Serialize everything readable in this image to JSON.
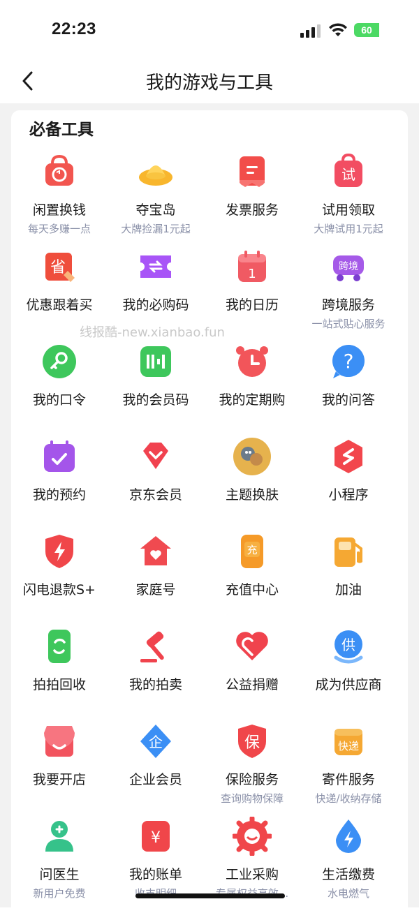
{
  "status_bar": {
    "time": "22:23",
    "battery": "60",
    "battery_color": "#4cd964"
  },
  "nav": {
    "title": "我的游戏与工具",
    "back_icon": "chevron-left-icon"
  },
  "section": {
    "title": "必备工具"
  },
  "watermark": "线报酷-new.xianbao.fun",
  "tools": [
    {
      "name": "闲置换钱",
      "sub": "每天多赚一点",
      "icon": "bag-swap-icon"
    },
    {
      "name": "夺宝岛",
      "sub": "大牌捡漏1元起",
      "icon": "gold-ingot-icon"
    },
    {
      "name": "发票服务",
      "sub": "",
      "icon": "invoice-icon"
    },
    {
      "name": "试用领取",
      "sub": "大牌试用1元起",
      "icon": "trial-bag-icon"
    },
    {
      "name": "优惠跟着买",
      "sub": "",
      "icon": "save-tag-icon"
    },
    {
      "name": "我的必购码",
      "sub": "",
      "icon": "ticket-icon"
    },
    {
      "name": "我的日历",
      "sub": "",
      "icon": "calendar-icon"
    },
    {
      "name": "跨境服务",
      "sub": "一站式贴心服务",
      "icon": "cross-border-truck-icon"
    },
    {
      "name": "我的口令",
      "sub": "",
      "icon": "key-icon"
    },
    {
      "name": "我的会员码",
      "sub": "",
      "icon": "member-code-icon"
    },
    {
      "name": "我的定期购",
      "sub": "",
      "icon": "alarm-clock-icon"
    },
    {
      "name": "我的问答",
      "sub": "",
      "icon": "question-bubble-icon"
    },
    {
      "name": "我的预约",
      "sub": "",
      "icon": "calendar-check-icon"
    },
    {
      "name": "京东会员",
      "sub": "",
      "icon": "diamond-icon"
    },
    {
      "name": "主题换肤",
      "sub": "",
      "icon": "theme-avatar-icon"
    },
    {
      "name": "小程序",
      "sub": "",
      "icon": "mini-program-icon"
    },
    {
      "name": "闪电退款S+",
      "sub": "",
      "icon": "lightning-shield-icon"
    },
    {
      "name": "家庭号",
      "sub": "",
      "icon": "home-heart-icon"
    },
    {
      "name": "充值中心",
      "sub": "",
      "icon": "recharge-icon"
    },
    {
      "name": "加油",
      "sub": "",
      "icon": "fuel-pump-icon"
    },
    {
      "name": "拍拍回收",
      "sub": "",
      "icon": "recycle-phone-icon"
    },
    {
      "name": "我的拍卖",
      "sub": "",
      "icon": "auction-hammer-icon"
    },
    {
      "name": "公益捐赠",
      "sub": "",
      "icon": "charity-heart-icon"
    },
    {
      "name": "成为供应商",
      "sub": "",
      "icon": "supplier-icon"
    },
    {
      "name": "我要开店",
      "sub": "",
      "icon": "shop-icon"
    },
    {
      "name": "企业会员",
      "sub": "",
      "icon": "enterprise-icon"
    },
    {
      "name": "保险服务",
      "sub": "查询购物保障",
      "icon": "insurance-shield-icon"
    },
    {
      "name": "寄件服务",
      "sub": "快递/收纳存储",
      "icon": "express-box-icon"
    },
    {
      "name": "问医生",
      "sub": "新用户免费",
      "icon": "doctor-icon"
    },
    {
      "name": "我的账单",
      "sub": "收支明细",
      "icon": "bill-icon"
    },
    {
      "name": "工业采购",
      "sub": "专属权益高效...",
      "icon": "industrial-gear-icon"
    },
    {
      "name": "生活缴费",
      "sub": "水电燃气",
      "icon": "utility-drop-icon"
    }
  ]
}
